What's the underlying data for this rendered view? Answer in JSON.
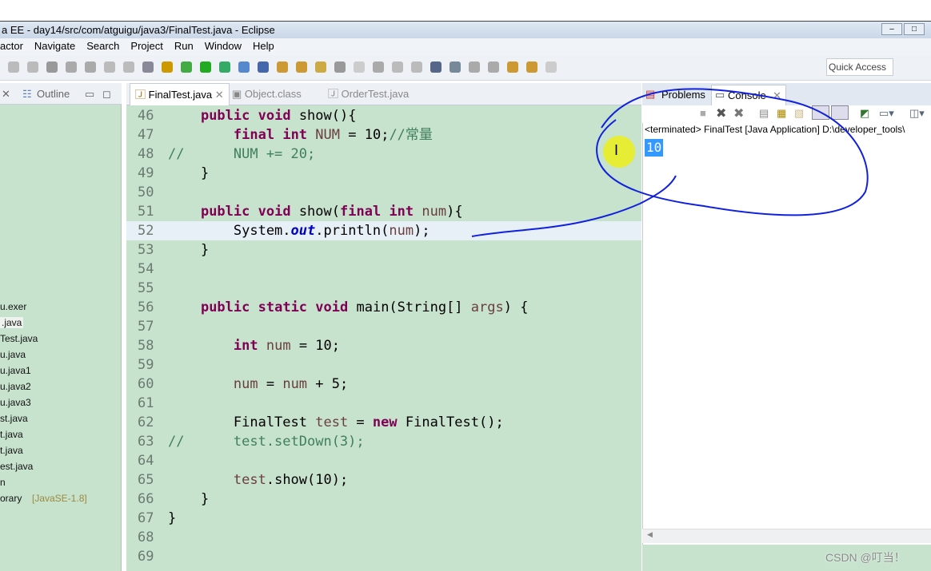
{
  "window": {
    "title": "a EE - day14/src/com/atguigu/java3/FinalTest.java - Eclipse"
  },
  "menu": [
    "actor",
    "Navigate",
    "Search",
    "Project",
    "Run",
    "Window",
    "Help"
  ],
  "toolbar": {
    "quick_access": "Quick Access"
  },
  "left_panel": {
    "tab_outline": "Outline",
    "tree": [
      "u.exer",
      ".java",
      "Test.java",
      "u.java",
      "u.java1",
      "u.java2",
      "u.java3",
      "st.java",
      "t.java",
      "t.java",
      "est.java",
      "n",
      "orary"
    ],
    "library_suffix": "[JavaSE-1.8]"
  },
  "editor": {
    "tabs": [
      "FinalTest.java",
      "Object.class",
      "OrderTest.java"
    ],
    "current_line": 52,
    "lines": [
      {
        "n": "46",
        "t": [
          [
            "    "
          ],
          [
            "public",
            "kw"
          ],
          [
            " "
          ],
          [
            "void",
            "kw"
          ],
          [
            " show(){"
          ]
        ]
      },
      {
        "n": "47",
        "t": [
          [
            "        "
          ],
          [
            "final",
            "kw"
          ],
          [
            " "
          ],
          [
            "int",
            "kw"
          ],
          [
            " "
          ],
          [
            "NUM",
            "var"
          ],
          [
            " = 10;"
          ],
          [
            "//常量",
            "cm"
          ]
        ]
      },
      {
        "n": "48",
        "t": [
          [
            "//      NUM += 20;",
            "cm"
          ]
        ]
      },
      {
        "n": "49",
        "t": [
          [
            "    }"
          ]
        ]
      },
      {
        "n": "50",
        "t": [
          [
            ""
          ]
        ]
      },
      {
        "n": "51",
        "t": [
          [
            "    "
          ],
          [
            "public",
            "kw"
          ],
          [
            " "
          ],
          [
            "void",
            "kw"
          ],
          [
            " show("
          ],
          [
            "final",
            "kw"
          ],
          [
            " "
          ],
          [
            "int",
            "kw"
          ],
          [
            " "
          ],
          [
            "num",
            "var"
          ],
          [
            "){"
          ]
        ]
      },
      {
        "n": "52",
        "t": [
          [
            "        System."
          ],
          [
            "out",
            "fld"
          ],
          [
            ".println("
          ],
          [
            "num",
            "var"
          ],
          [
            ");"
          ]
        ]
      },
      {
        "n": "53",
        "t": [
          [
            "    }"
          ]
        ]
      },
      {
        "n": "54",
        "t": [
          [
            ""
          ]
        ]
      },
      {
        "n": "55",
        "t": [
          [
            ""
          ]
        ]
      },
      {
        "n": "56",
        "t": [
          [
            "    "
          ],
          [
            "public",
            "kw"
          ],
          [
            " "
          ],
          [
            "static",
            "kw"
          ],
          [
            " "
          ],
          [
            "void",
            "kw"
          ],
          [
            " main(String[] "
          ],
          [
            "args",
            "var"
          ],
          [
            ") {"
          ]
        ]
      },
      {
        "n": "57",
        "t": [
          [
            ""
          ]
        ]
      },
      {
        "n": "58",
        "t": [
          [
            "        "
          ],
          [
            "int",
            "kw"
          ],
          [
            " "
          ],
          [
            "num",
            "var"
          ],
          [
            " = 10;"
          ]
        ]
      },
      {
        "n": "59",
        "t": [
          [
            ""
          ]
        ]
      },
      {
        "n": "60",
        "t": [
          [
            "        "
          ],
          [
            "num",
            "var"
          ],
          [
            " = "
          ],
          [
            "num",
            "var"
          ],
          [
            " + 5;"
          ]
        ]
      },
      {
        "n": "61",
        "t": [
          [
            ""
          ]
        ]
      },
      {
        "n": "62",
        "t": [
          [
            "        FinalTest "
          ],
          [
            "test",
            "var"
          ],
          [
            " = "
          ],
          [
            "new",
            "kw"
          ],
          [
            " FinalTest();"
          ]
        ]
      },
      {
        "n": "63",
        "t": [
          [
            "//      test.setDown(3);",
            "cm"
          ]
        ]
      },
      {
        "n": "64",
        "t": [
          [
            ""
          ]
        ]
      },
      {
        "n": "65",
        "t": [
          [
            "        "
          ],
          [
            "test",
            "var"
          ],
          [
            ".show(10);"
          ]
        ]
      },
      {
        "n": "66",
        "t": [
          [
            "    }"
          ]
        ]
      },
      {
        "n": "67",
        "t": [
          [
            "}"
          ]
        ]
      },
      {
        "n": "68",
        "t": [
          [
            ""
          ]
        ]
      },
      {
        "n": "69",
        "t": [
          [
            ""
          ]
        ]
      }
    ]
  },
  "console": {
    "tab_problems": "Problems",
    "tab_console": "Console",
    "status": "<terminated> FinalTest [Java Application] D:\\developer_tools\\",
    "output": "10"
  },
  "watermark": "CSDN @叮当！",
  "colors": {
    "editor_bg": "#c7e3cd",
    "annotation": "#1020e0",
    "keyword": "#7f0055"
  }
}
